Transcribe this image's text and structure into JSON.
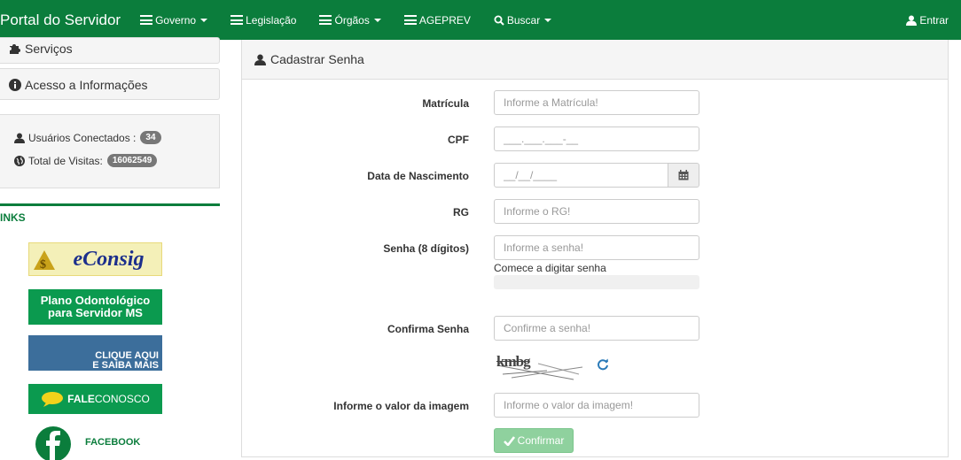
{
  "navbar": {
    "brand": "Portal do Servidor",
    "items": [
      {
        "label": "Governo",
        "dropdown": true,
        "icon": "menu-icon"
      },
      {
        "label": "Legislação",
        "dropdown": false,
        "icon": "menu-icon"
      },
      {
        "label": "Órgãos",
        "dropdown": true,
        "icon": "menu-icon"
      },
      {
        "label": "AGEPREV",
        "dropdown": false,
        "icon": "menu-icon"
      },
      {
        "label": "Buscar",
        "dropdown": true,
        "icon": "search-icon"
      }
    ],
    "login_label": "Entrar"
  },
  "sidebar": {
    "servicos": "Serviços",
    "acesso": "Acesso a Informações",
    "usuarios_label": "Usuários Conectados :",
    "usuarios_count": "34",
    "visitas_label": "Total de Visitas:",
    "visitas_count": "16062549",
    "links_title": "INKS",
    "banners": {
      "econsig": "eConsig",
      "odonto_line1": "Plano Odontológico",
      "odonto_line2": "para Servidor MS",
      "clique_line1": "CLIQUE AQUI",
      "clique_line2": "E SAIBA MAIS",
      "fale_bold": "FALE",
      "fale_rest": "CONOSCO",
      "facebook": "FACEBOOK"
    }
  },
  "form": {
    "title": "Cadastrar Senha",
    "fields": {
      "matricula": {
        "label": "Matrícula",
        "placeholder": "Informe a Matrícula!"
      },
      "cpf": {
        "label": "CPF",
        "placeholder": "___.___.___-__"
      },
      "nascimento": {
        "label": "Data de Nascimento",
        "placeholder": "__/__/____"
      },
      "rg": {
        "label": "RG",
        "placeholder": "Informe o RG!"
      },
      "senha": {
        "label": "Senha (8 dígitos)",
        "placeholder": "Informe a senha!"
      },
      "confirma": {
        "label": "Confirma Senha",
        "placeholder": "Confirme a senha!"
      },
      "imagem": {
        "label": "Informe o valor da imagem",
        "placeholder": "Informe o valor da imagem!"
      }
    },
    "password_hint": "Comece a digitar senha",
    "captcha_text": "kmbg",
    "submit_label": "Confirmar"
  },
  "colors": {
    "brand_green": "#0b7d3c",
    "button_green": "#8fd19e"
  }
}
